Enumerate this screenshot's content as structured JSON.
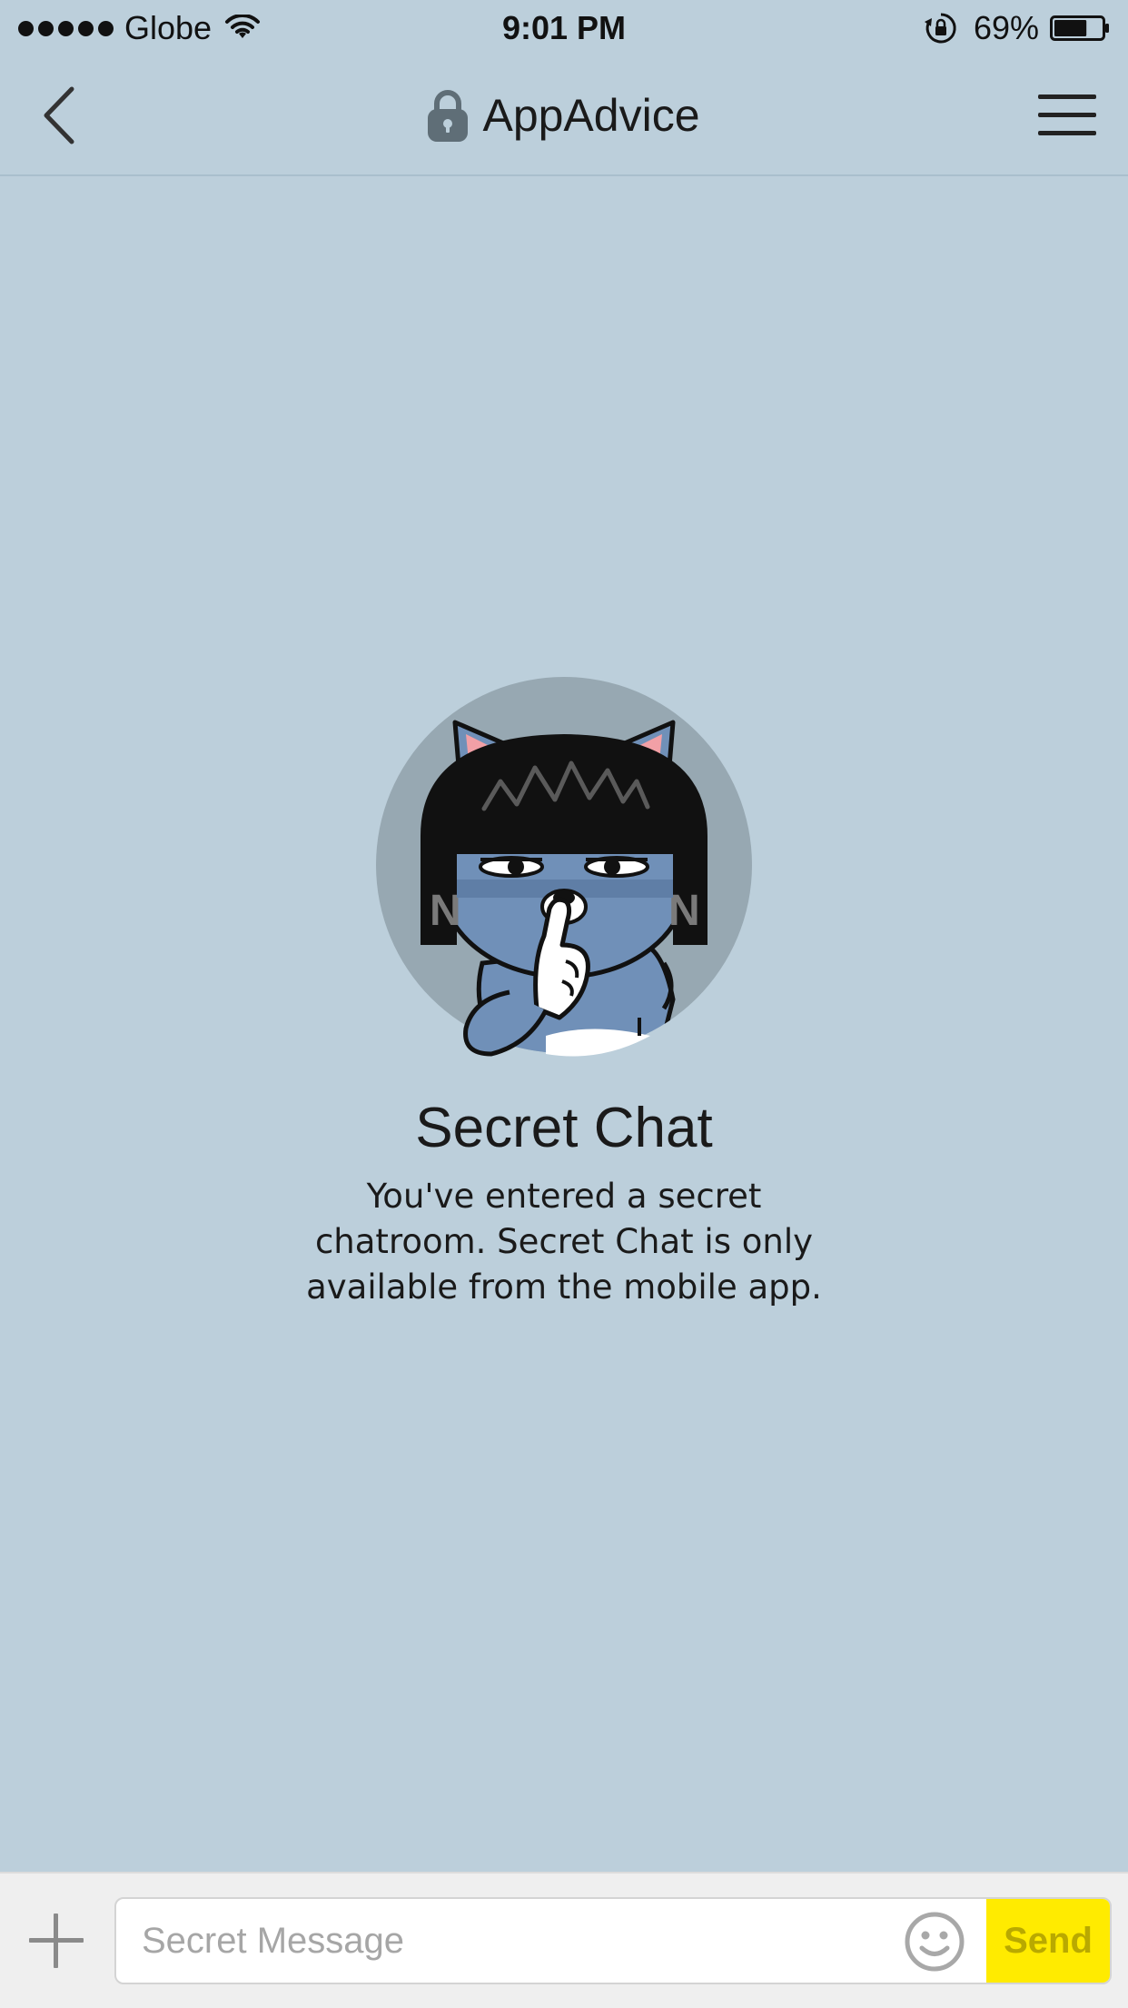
{
  "status_bar": {
    "carrier": "Globe",
    "time": "9:01 PM",
    "battery_percent": "69%",
    "battery_level": 0.69,
    "signal_bars": 5,
    "icons": [
      "signal-dots-icon",
      "wifi-icon",
      "rotation-lock-icon",
      "battery-icon"
    ]
  },
  "nav": {
    "title": "AppAdvice",
    "back_icon": "chevron-left-icon",
    "lock_icon": "lock-icon",
    "menu_icon": "hamburger-menu-icon"
  },
  "intro": {
    "image": "character-shush-avatar",
    "title": "Secret Chat",
    "description": "You've entered a secret chatroom. Secret Chat is only available from the mobile app."
  },
  "input_bar": {
    "plus_icon": "plus-icon",
    "placeholder": "Secret Message",
    "value": "",
    "emoji_icon": "smiley-icon",
    "send_label": "Send"
  },
  "colors": {
    "background": "#bccfdb",
    "send_button": "#ffeb00",
    "send_text": "#b9a900",
    "input_bar": "#efefef",
    "avatar_circle": "#97a8b2"
  }
}
